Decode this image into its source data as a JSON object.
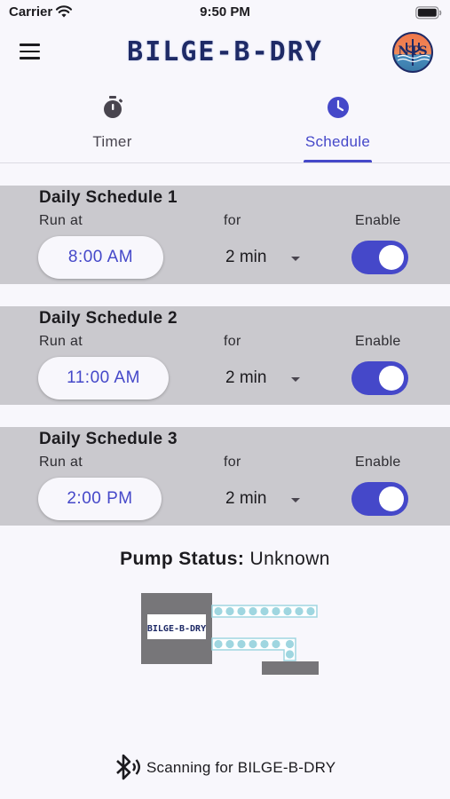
{
  "status_bar": {
    "carrier": "Carrier",
    "time": "9:50 PM"
  },
  "app_bar": {
    "title": "BILGE-B-DRY",
    "logo_monogram": "NTS"
  },
  "tabs": [
    {
      "label": "Timer",
      "icon": "stopwatch-icon",
      "selected": false
    },
    {
      "label": "Schedule",
      "icon": "clock-icon",
      "selected": true
    }
  ],
  "schedules": [
    {
      "title": "Daily Schedule 1",
      "run_label": "Run at",
      "for_label": "for",
      "enable_label": "Enable",
      "time": "8:00 AM",
      "duration": "2 min",
      "enabled": true
    },
    {
      "title": "Daily Schedule 2",
      "run_label": "Run at",
      "for_label": "for",
      "enable_label": "Enable",
      "time": "11:00 AM",
      "duration": "2 min",
      "enabled": true
    },
    {
      "title": "Daily Schedule 3",
      "run_label": "Run at",
      "for_label": "for",
      "enable_label": "Enable",
      "time": "2:00 PM",
      "duration": "2 min",
      "enabled": true
    }
  ],
  "pump": {
    "status_key": "Pump Status:",
    "status_value": "Unknown",
    "device_label": "BILGE-B-DRY"
  },
  "bluetooth": {
    "message": "Scanning for BILGE-B-DRY",
    "icon": "bluetooth-searching-icon"
  },
  "colors": {
    "accent": "#4548c9",
    "card_bg": "#cac9ce",
    "page_bg": "#f8f7fc",
    "brand_text": "#1e2a66",
    "water": "#9fd6e0"
  }
}
